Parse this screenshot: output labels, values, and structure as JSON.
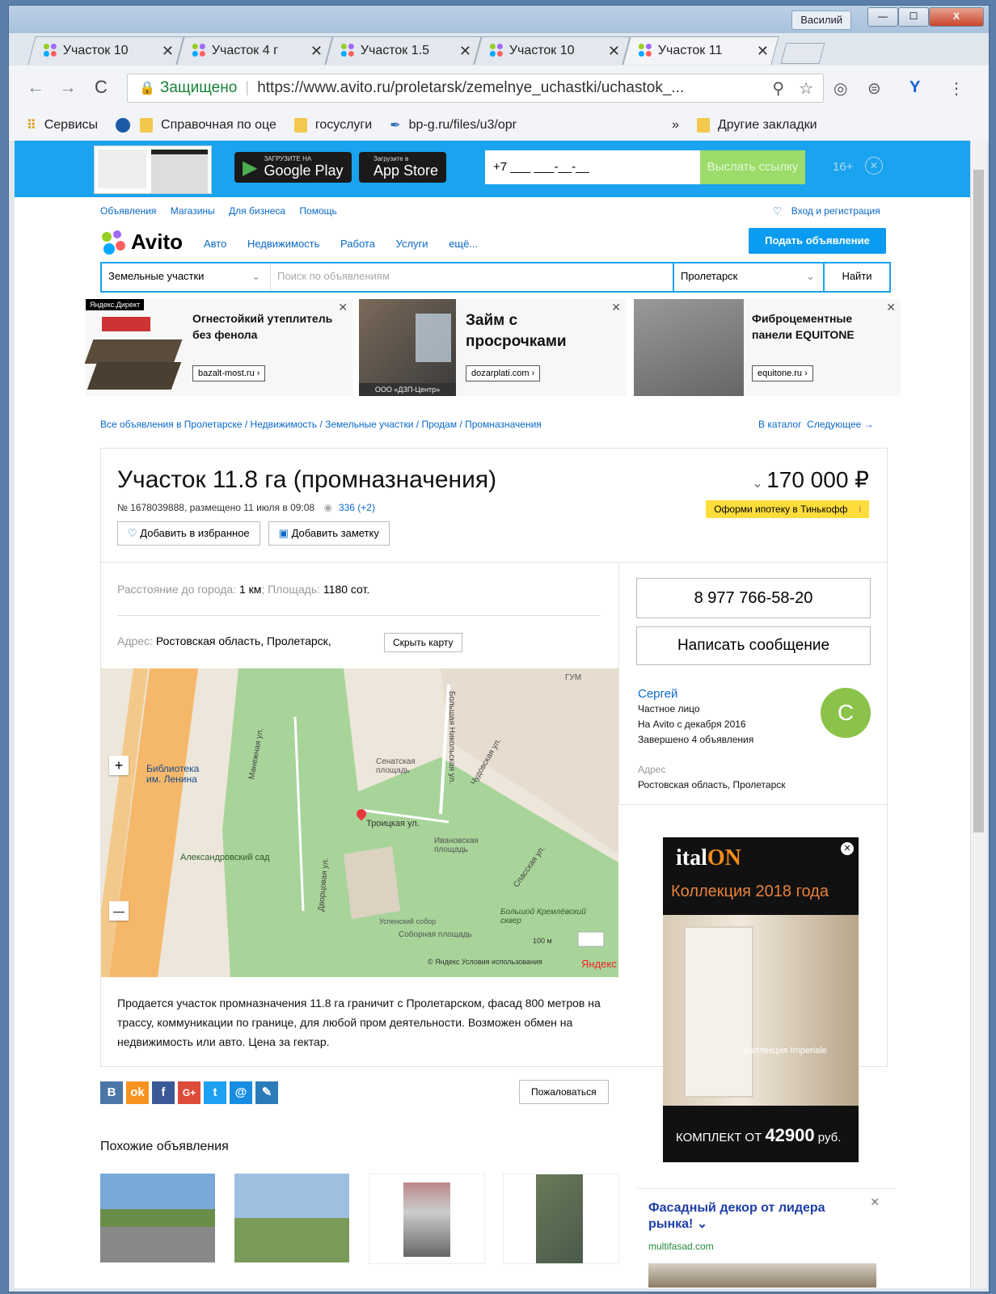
{
  "window": {
    "user": "Василий",
    "min": "—",
    "max": "☐",
    "close": "X"
  },
  "tabs": [
    {
      "title": "Участок 10"
    },
    {
      "title": "Участок 4 г"
    },
    {
      "title": "Участок 1.5"
    },
    {
      "title": "Участок 10"
    },
    {
      "title": "Участок 11"
    }
  ],
  "tab_close": "✕",
  "toolbar": {
    "secure": "Защищено",
    "url": "https://www.avito.ru/proletarsk/zemelnye_uchastki/uchastok_..."
  },
  "bookmarks": {
    "services": "Сервисы",
    "items": [
      "Справочная по оце",
      "госуслуги",
      "bp-g.ru/files/u3/opr"
    ],
    "more": "»",
    "other": "Другие закладки"
  },
  "appbar": {
    "gp_small": "ЗАГРУЗИТЕ НА",
    "gp": "Google Play",
    "as_small": "Загрузите в",
    "as": "App Store",
    "phone_placeholder": "+7 ___ ___-__-__",
    "send": "Выслать ссылку",
    "age": "16+",
    "close": "✕"
  },
  "topnav": [
    "Объявления",
    "Магазины",
    "Для бизнеса",
    "Помощь"
  ],
  "login": "Вход и регистрация",
  "logo": "Avito",
  "catnav": [
    "Авто",
    "Недвижимость",
    "Работа",
    "Услуги",
    "ещё..."
  ],
  "post_ad": "Подать объявление",
  "search": {
    "category": "Земельные участки",
    "placeholder": "Поиск по объявлениям",
    "city": "Пролетарск",
    "button": "Найти"
  },
  "ads": [
    {
      "title": "Огнестойкий утеплитель без фенола",
      "link": "bazalt-most.ru ›",
      "label": "Яндекс.Директ"
    },
    {
      "title": "Займ с просрочками",
      "link": "dozarplati.com ›",
      "caption": "ООО «ДЗП-Центр»"
    },
    {
      "title": "Фиброцементные панели EQUITONE",
      "link": "equitone.ru ›"
    }
  ],
  "breadcrumb": "Все объявления в Пролетарске / Недвижимость / Земельные участки / Продам / Промназначения",
  "bc_right": {
    "catalog": "В каталог",
    "next": "Следующее →"
  },
  "listing": {
    "title": "Участок 11.8 га (промназначения)",
    "meta": "№ 1678039888, размещено 11 июля в 09:08",
    "views": "336 (+2)",
    "fav": "Добавить в избранное",
    "note": "Добавить заметку",
    "price": "170 000 ₽",
    "mortgage": "Оформи ипотеку в Тинькофф",
    "param_dist_lbl": "Расстояние до города:",
    "param_dist": "1 км",
    "param_area_lbl": "Площадь:",
    "param_area": "1180 сот.",
    "addr_lbl": "Адрес:",
    "addr": "Ростовская область, Пролетарск,",
    "hide_map": "Скрыть карту",
    "description": "Продается участок промназначения 11.8 га граничит с Пролетарском, фасад 800 метров на трассу, коммуникации по границе, для любой пром деятельности. Возможен обмен на недвижимость или авто. Цена за гектар."
  },
  "map_labels": {
    "a": "Сенатская площадь",
    "b": "Троицкая ул.",
    "c": "Ивановская площадь",
    "d": "Александровский сад",
    "e": "Соборная площадь",
    "f": "Большой Кремлёвский сквер",
    "g": "Библиотека им. Ленина",
    "h": "Манежная ул.",
    "i": "Большая Никольская ул.",
    "j": "Чудовская ул.",
    "k": "Спасская ул.",
    "l": "Дворцовая ул.",
    "m": "Успенский собор",
    "n": "ГУМ",
    "scale": "100 м",
    "yandex": "Яндекс",
    "terms": "© Яндекс Условия использования",
    "plus": "+",
    "minus": "—"
  },
  "seller": {
    "phone": "8 977 766-58-20",
    "message": "Написать сообщение",
    "name": "Сергей",
    "type": "Частное лицо",
    "since": "На Avito с декабря 2016",
    "done": "Завершено 4 объявления",
    "avatar": "С",
    "addr_lbl": "Адрес",
    "addr": "Ростовская область, Пролетарск"
  },
  "social": [
    "B",
    "ok",
    "f",
    "G+",
    "t",
    "@",
    "✎"
  ],
  "complain": "Пожаловаться",
  "similar": "Похожие объявления",
  "banner": {
    "brand_a": "ital",
    "brand_b": "ON",
    "coll": "Коллекция 2018 года",
    "imp": "Коллекция Imperiale",
    "kit_a": "КОМПЛЕКТ ОТ ",
    "kit_b": "42900",
    "kit_c": " руб."
  },
  "ad2": {
    "title": "Фасадный декор от лидера рынка! ⌄",
    "url": "multifasad.com",
    "close": "✕"
  }
}
